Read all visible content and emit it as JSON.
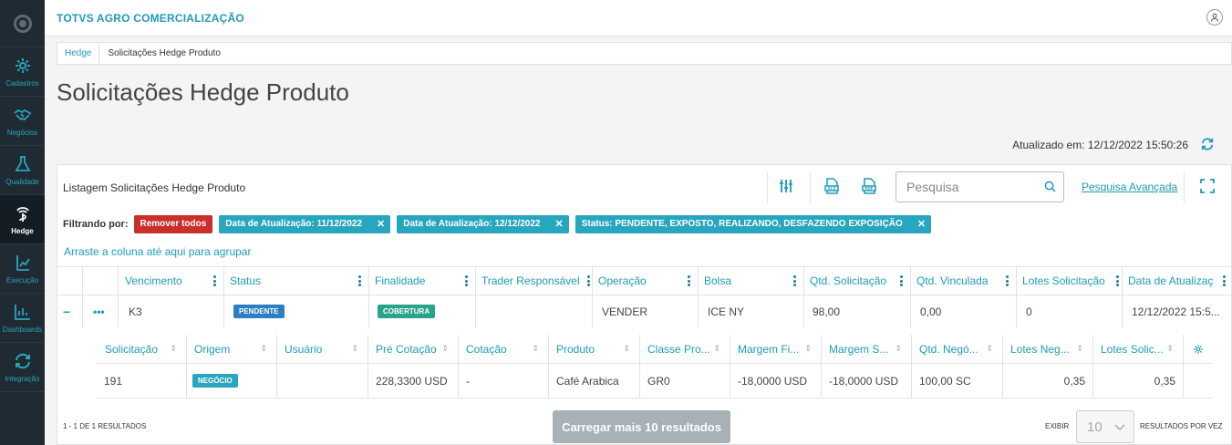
{
  "sidebar": {
    "items": [
      {
        "label": "Cadastros",
        "icon": "gear-icon",
        "active": false
      },
      {
        "label": "Negócios",
        "icon": "handshake-icon",
        "active": false
      },
      {
        "label": "Qualidade",
        "icon": "flask-icon",
        "active": false
      },
      {
        "label": "Hedge",
        "icon": "hedge-icon",
        "active": true
      },
      {
        "label": "Execução",
        "icon": "execution-icon",
        "active": false
      },
      {
        "label": "Dashboards",
        "icon": "chart-icon",
        "active": false
      },
      {
        "label": "Integração",
        "icon": "sync-icon",
        "active": false
      }
    ]
  },
  "header": {
    "brand": "TOTVS AGRO COMERCIALIZAÇÃO"
  },
  "breadcrumb": {
    "link": "Hedge",
    "current": "Solicitações Hedge Produto"
  },
  "page": {
    "title": "Solicitações Hedge Produto",
    "updated": "Atualizado em: 12/12/2022 15:50:26"
  },
  "panel": {
    "title": "Listagem Solicitações Hedge Produto",
    "search_placeholder": "Pesquisa",
    "advanced_search": "Pesquisa Avançada",
    "filter_label": "Filtrando por:",
    "remove_all": "Remover todos",
    "filters": [
      "Data de Atualização: 11/12/2022",
      "Data de Atualização: 12/12/2022",
      "Status: PENDENTE, EXPOSTO, REALIZANDO, DESFAZENDO EXPOSIÇÃO"
    ],
    "group_hint": "Arraste a coluna até aqui para agrupar"
  },
  "grid": {
    "columns": [
      "Vencimento",
      "Status",
      "Finalidade",
      "Trader Responsável",
      "Operação",
      "Bolsa",
      "Qtd. Solicitação",
      "Qtd. Vinculada",
      "Lotes Solicitação",
      "Data de Atualizaç"
    ],
    "row": {
      "expand": "−",
      "actions": "•••",
      "vencimento": "K3",
      "status": "PENDENTE",
      "finalidade": "COBERTURA",
      "trader": "",
      "operacao": "VENDER",
      "bolsa": "ICE NY",
      "qtd_solicitacao": "98,00",
      "qtd_vinculada": "0,00",
      "lotes_solicitacao": "0",
      "data_atualizacao": "12/12/2022 15:5..."
    }
  },
  "detail": {
    "columns": [
      "Solicitação",
      "Origem",
      "Usuário",
      "Pré Cotação",
      "Cotação",
      "Produto",
      "Classe Pro...",
      "Margem Fi...",
      "Margem S...",
      "Qtd. Negó...",
      "Lotes Neg...",
      "Lotes Solic..."
    ],
    "row": {
      "solicitacao": "191",
      "origem": "NEGÓCIO",
      "usuario": "",
      "pre_cotacao": "228,3300 USD",
      "cotacao": "-",
      "produto": "Café Arabica",
      "classe": "GR0",
      "margem_fi": "-18,0000 USD",
      "margem_s": "-18,0000 USD",
      "qtd_neg": "100,00 SC",
      "lotes_neg": "0,35",
      "lotes_solic": "0,35"
    }
  },
  "footer": {
    "count": "1 - 1 DE 1 RESULTADOS",
    "load_more": "Carregar mais 10 resultados",
    "exhibit": "EXIBIR",
    "per_page": "10",
    "per_page_label": "RESULTADOS POR VEZ"
  },
  "colors": {
    "accent": "#1f9bb6",
    "sidebar": "#1f2a32",
    "danger": "#c9302c",
    "chip": "#29a6bf"
  }
}
